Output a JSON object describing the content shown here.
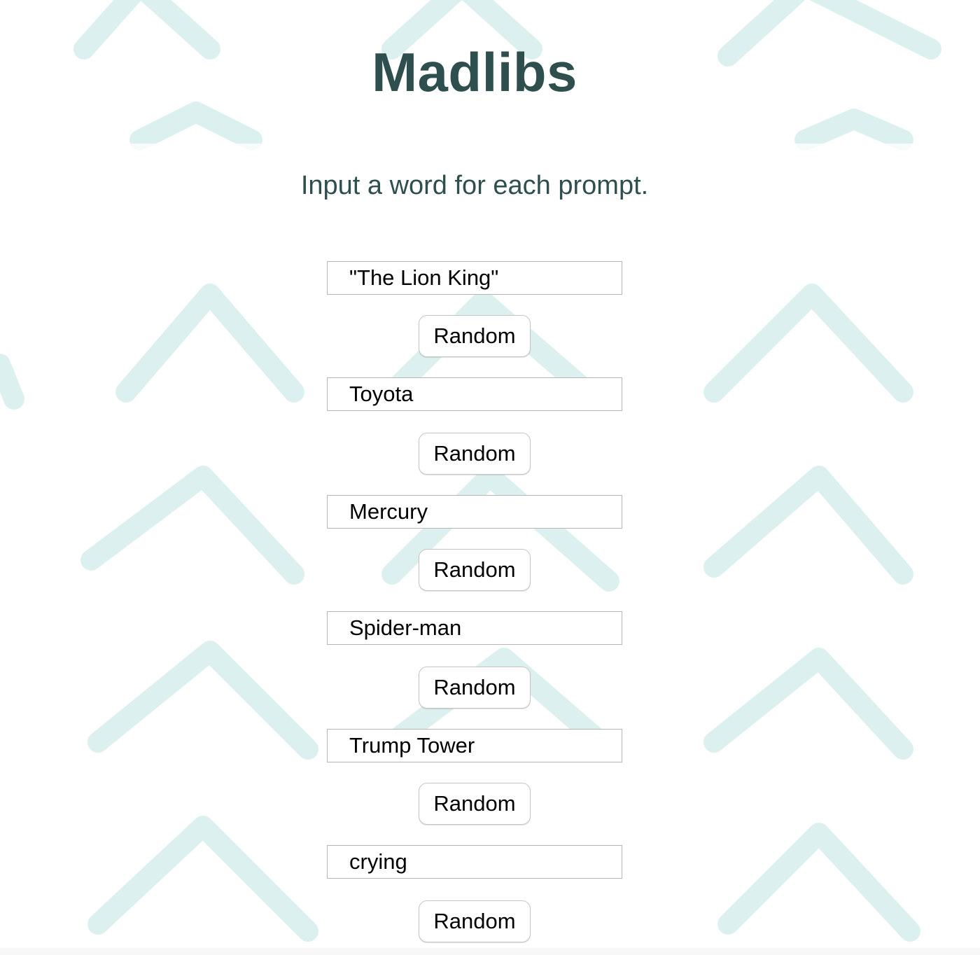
{
  "page": {
    "title": "Madlibs",
    "instructions": "Input a word for each prompt.",
    "colors": {
      "heading": "#2f4f4f",
      "background_pattern": "#bfe6e2"
    }
  },
  "prompts": [
    {
      "value": "\"The Lion King\"",
      "button_label": "Random"
    },
    {
      "value": "Toyota",
      "button_label": "Random"
    },
    {
      "value": "Mercury",
      "button_label": "Random"
    },
    {
      "value": "Spider-man",
      "button_label": "Random"
    },
    {
      "value": "Trump Tower",
      "button_label": "Random"
    },
    {
      "value": "crying",
      "button_label": "Random"
    }
  ]
}
